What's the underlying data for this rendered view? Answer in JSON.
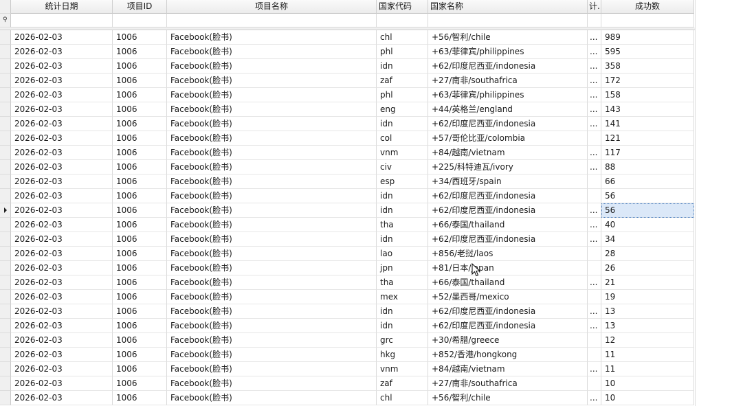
{
  "columns": {
    "date": "统计日期",
    "pid": "项目ID",
    "pname": "项目名称",
    "ccode": "国家代码",
    "cname": "国家名称",
    "x": "计..",
    "succ": "成功数"
  },
  "filter_icon": "filter-pin-icon",
  "rows": [
    {
      "date": "2026-02-03",
      "pid": "1006",
      "pname": "Facebook(脸书)",
      "ccode": "chl",
      "cname": "+56/智利/chile",
      "x": "...",
      "succ": "989"
    },
    {
      "date": "2026-02-03",
      "pid": "1006",
      "pname": "Facebook(脸书)",
      "ccode": "phl",
      "cname": "+63/菲律宾/philippines",
      "x": "...",
      "succ": "595"
    },
    {
      "date": "2026-02-03",
      "pid": "1006",
      "pname": "Facebook(脸书)",
      "ccode": "idn",
      "cname": "+62/印度尼西亚/indonesia",
      "x": "...",
      "succ": "358"
    },
    {
      "date": "2026-02-03",
      "pid": "1006",
      "pname": "Facebook(脸书)",
      "ccode": "zaf",
      "cname": "+27/南非/southafrica",
      "x": "...",
      "succ": "172"
    },
    {
      "date": "2026-02-03",
      "pid": "1006",
      "pname": "Facebook(脸书)",
      "ccode": "phl",
      "cname": "+63/菲律宾/philippines",
      "x": "...",
      "succ": "158"
    },
    {
      "date": "2026-02-03",
      "pid": "1006",
      "pname": "Facebook(脸书)",
      "ccode": "eng",
      "cname": "+44/英格兰/england",
      "x": "...",
      "succ": "143"
    },
    {
      "date": "2026-02-03",
      "pid": "1006",
      "pname": "Facebook(脸书)",
      "ccode": "idn",
      "cname": "+62/印度尼西亚/indonesia",
      "x": "...",
      "succ": "141"
    },
    {
      "date": "2026-02-03",
      "pid": "1006",
      "pname": "Facebook(脸书)",
      "ccode": "col",
      "cname": "+57/哥伦比亚/colombia",
      "x": "",
      "succ": "121"
    },
    {
      "date": "2026-02-03",
      "pid": "1006",
      "pname": "Facebook(脸书)",
      "ccode": "vnm",
      "cname": "+84/越南/vietnam",
      "x": "...",
      "succ": "117"
    },
    {
      "date": "2026-02-03",
      "pid": "1006",
      "pname": "Facebook(脸书)",
      "ccode": "civ",
      "cname": "+225/科特迪瓦/ivory",
      "x": "...",
      "succ": "88"
    },
    {
      "date": "2026-02-03",
      "pid": "1006",
      "pname": "Facebook(脸书)",
      "ccode": "esp",
      "cname": "+34/西班牙/spain",
      "x": "",
      "succ": "66"
    },
    {
      "date": "2026-02-03",
      "pid": "1006",
      "pname": "Facebook(脸书)",
      "ccode": "idn",
      "cname": "+62/印度尼西亚/indonesia",
      "x": "",
      "succ": "56"
    },
    {
      "date": "2026-02-03",
      "pid": "1006",
      "pname": "Facebook(脸书)",
      "ccode": "idn",
      "cname": "+62/印度尼西亚/indonesia",
      "x": "...",
      "succ": "56",
      "selected": true
    },
    {
      "date": "2026-02-03",
      "pid": "1006",
      "pname": "Facebook(脸书)",
      "ccode": "tha",
      "cname": "+66/泰国/thailand",
      "x": "...",
      "succ": "40"
    },
    {
      "date": "2026-02-03",
      "pid": "1006",
      "pname": "Facebook(脸书)",
      "ccode": "idn",
      "cname": "+62/印度尼西亚/indonesia",
      "x": "...",
      "succ": "34"
    },
    {
      "date": "2026-02-03",
      "pid": "1006",
      "pname": "Facebook(脸书)",
      "ccode": "lao",
      "cname": "+856/老挝/laos",
      "x": "",
      "succ": "28"
    },
    {
      "date": "2026-02-03",
      "pid": "1006",
      "pname": "Facebook(脸书)",
      "ccode": "jpn",
      "cname": "+81/日本/japan",
      "x": "",
      "succ": "26"
    },
    {
      "date": "2026-02-03",
      "pid": "1006",
      "pname": "Facebook(脸书)",
      "ccode": "tha",
      "cname": "+66/泰国/thailand",
      "x": "...",
      "succ": "21"
    },
    {
      "date": "2026-02-03",
      "pid": "1006",
      "pname": "Facebook(脸书)",
      "ccode": "mex",
      "cname": "+52/墨西哥/mexico",
      "x": "",
      "succ": "19"
    },
    {
      "date": "2026-02-03",
      "pid": "1006",
      "pname": "Facebook(脸书)",
      "ccode": "idn",
      "cname": "+62/印度尼西亚/indonesia",
      "x": "...",
      "succ": "13"
    },
    {
      "date": "2026-02-03",
      "pid": "1006",
      "pname": "Facebook(脸书)",
      "ccode": "idn",
      "cname": "+62/印度尼西亚/indonesia",
      "x": "...",
      "succ": "13"
    },
    {
      "date": "2026-02-03",
      "pid": "1006",
      "pname": "Facebook(脸书)",
      "ccode": "grc",
      "cname": "+30/希腊/greece",
      "x": "",
      "succ": "12"
    },
    {
      "date": "2026-02-03",
      "pid": "1006",
      "pname": "Facebook(脸书)",
      "ccode": "hkg",
      "cname": "+852/香港/hongkong",
      "x": "",
      "succ": "11"
    },
    {
      "date": "2026-02-03",
      "pid": "1006",
      "pname": "Facebook(脸书)",
      "ccode": "vnm",
      "cname": "+84/越南/vietnam",
      "x": "...",
      "succ": "11"
    },
    {
      "date": "2026-02-03",
      "pid": "1006",
      "pname": "Facebook(脸书)",
      "ccode": "zaf",
      "cname": "+27/南非/southafrica",
      "x": "",
      "succ": "10"
    },
    {
      "date": "2026-02-03",
      "pid": "1006",
      "pname": "Facebook(脸书)",
      "ccode": "chl",
      "cname": "+56/智利/chile",
      "x": "...",
      "succ": "10"
    }
  ],
  "colors": {
    "header_bg": "#f4f4f4",
    "grid_line": "#dadada",
    "selection": "#dbe8f8",
    "focus_outline": "#4a7fc1"
  }
}
